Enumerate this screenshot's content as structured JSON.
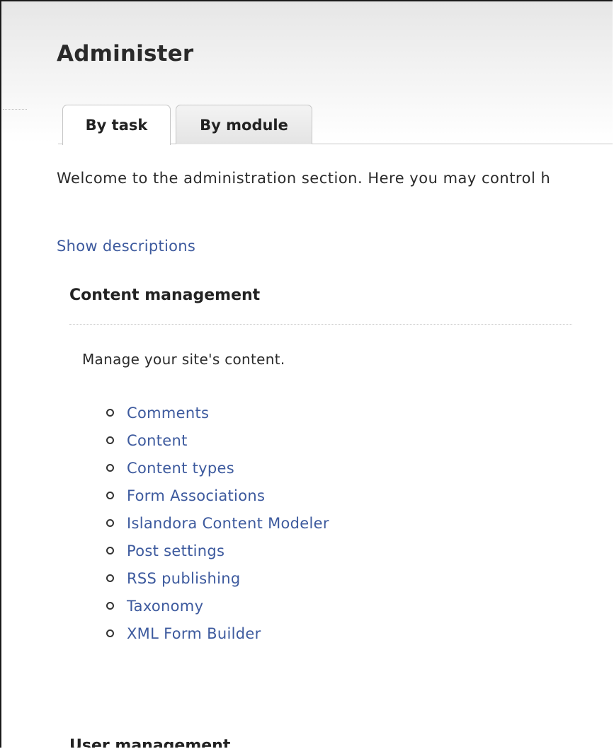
{
  "header": {
    "title": "Administer"
  },
  "tabs": [
    {
      "label": "By task",
      "active": true
    },
    {
      "label": "By module",
      "active": false
    }
  ],
  "intro_text": "Welcome to the administration section. Here you may control h",
  "show_descriptions_link": "Show descriptions",
  "sections": [
    {
      "title": "Content management",
      "description": "Manage your site's content.",
      "links": [
        "Comments",
        "Content",
        "Content types",
        "Form Associations",
        "Islandora Content Modeler",
        "Post settings",
        "RSS publishing",
        "Taxonomy",
        "XML Form Builder"
      ]
    },
    {
      "title": "User management"
    }
  ],
  "colors": {
    "link": "#3d5a9e",
    "text": "#222222",
    "border": "#1a1a1a"
  }
}
